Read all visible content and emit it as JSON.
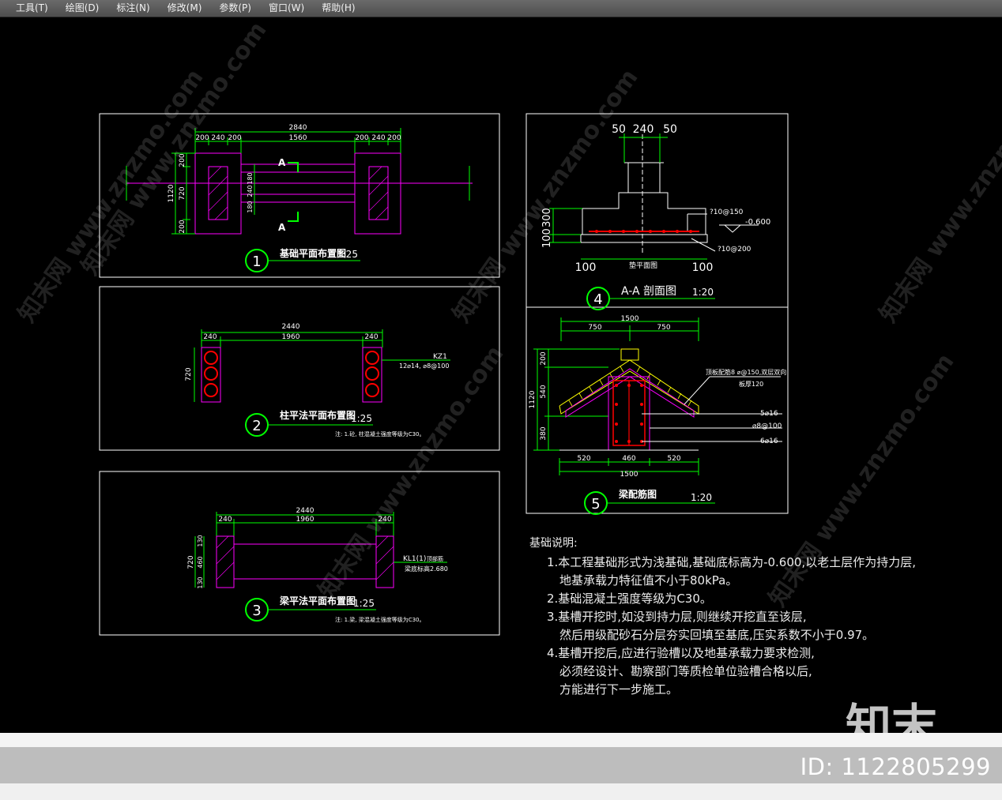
{
  "menu": [
    "工具(T)",
    "绘图(D)",
    "标注(N)",
    "修改(M)",
    "参数(P)",
    "窗口(W)",
    "帮助(H)"
  ],
  "watermark": "知末网 www.znzmo.com",
  "logo": "知末",
  "image_id": "ID: 1122805299",
  "colors": {
    "frame": "#ffffff",
    "dim": "#00ff00",
    "wall": "#ff00ff",
    "rebar": "#ff0000",
    "accent": "#ffff00"
  },
  "drawing1": {
    "number": "1",
    "title": "基础平面布置图",
    "scale": "1:25",
    "dims_top": [
      "2840"
    ],
    "dims_mid": [
      "200",
      "240",
      "200",
      "1560",
      "200",
      "240",
      "200"
    ],
    "dims_left": [
      "1120",
      "200",
      "720",
      "200"
    ],
    "dims_inner": [
      "180",
      "240",
      "180"
    ],
    "section_mark": "A"
  },
  "drawing2": {
    "number": "2",
    "title": "柱平法平面布置图",
    "scale": "1:25",
    "dims_top": [
      "2440",
      "240",
      "1960",
      "240"
    ],
    "dim_left": "720",
    "label": "KZ1",
    "label_detail": "12⌀14, ⌀8@100",
    "note": "注: 1.砼, 柱混凝土强度等级为C30。"
  },
  "drawing3": {
    "number": "3",
    "title": "梁平法平面布置图",
    "scale": "1:25",
    "dims_top": [
      "2440",
      "240",
      "1960",
      "240"
    ],
    "dims_left": [
      "720",
      "130",
      "460",
      "130"
    ],
    "label": "KL1(1)",
    "label_detail": "顶部筋",
    "elevation": "梁底标高2.680",
    "note": "注: 1.梁, 梁混凝土强度等级为C30。"
  },
  "drawing4": {
    "number": "4",
    "title": "A-A 剖面图",
    "scale": "1:20",
    "dims_top": [
      "50",
      "240",
      "50"
    ],
    "dims_left": [
      "100",
      "300"
    ],
    "dims_bottom": [
      "100",
      "100"
    ],
    "bottom_label": "垫平面图",
    "rebar_1": "?10@150",
    "rebar_2": "?10@200",
    "elevation": "-0.600"
  },
  "drawing5": {
    "number": "5",
    "title": "梁配筋图",
    "scale": "1:20",
    "dims_top": [
      "1500",
      "750",
      "750"
    ],
    "dims_left": [
      "1120",
      "200",
      "540",
      "380"
    ],
    "dims_bottom": [
      "520",
      "460",
      "520",
      "1500"
    ],
    "notes": [
      "顶板配筋8 ⌀@150,双层双向",
      "板厚120",
      "5⌀16",
      "⌀8@100",
      "6⌀16"
    ]
  },
  "notes_title": "基础说明:",
  "notes_lines": [
    "1.本工程基础形式为浅基础,基础底标高为-0.600,以老土层作为持力层,",
    "地基承载力特征值不小于80kPa。",
    "2.基础混凝土强度等级为C30。",
    "3.基槽开挖时,如没到持力层,则继续开挖直至该层,",
    "然后用级配砂石分层夯实回填至基底,压实系数不小于0.97。",
    "4.基槽开挖后,应进行验槽以及地基承载力要求检测,",
    "必须经设计、勘察部门等质检单位验槽合格以后,",
    "方能进行下一步施工。"
  ]
}
